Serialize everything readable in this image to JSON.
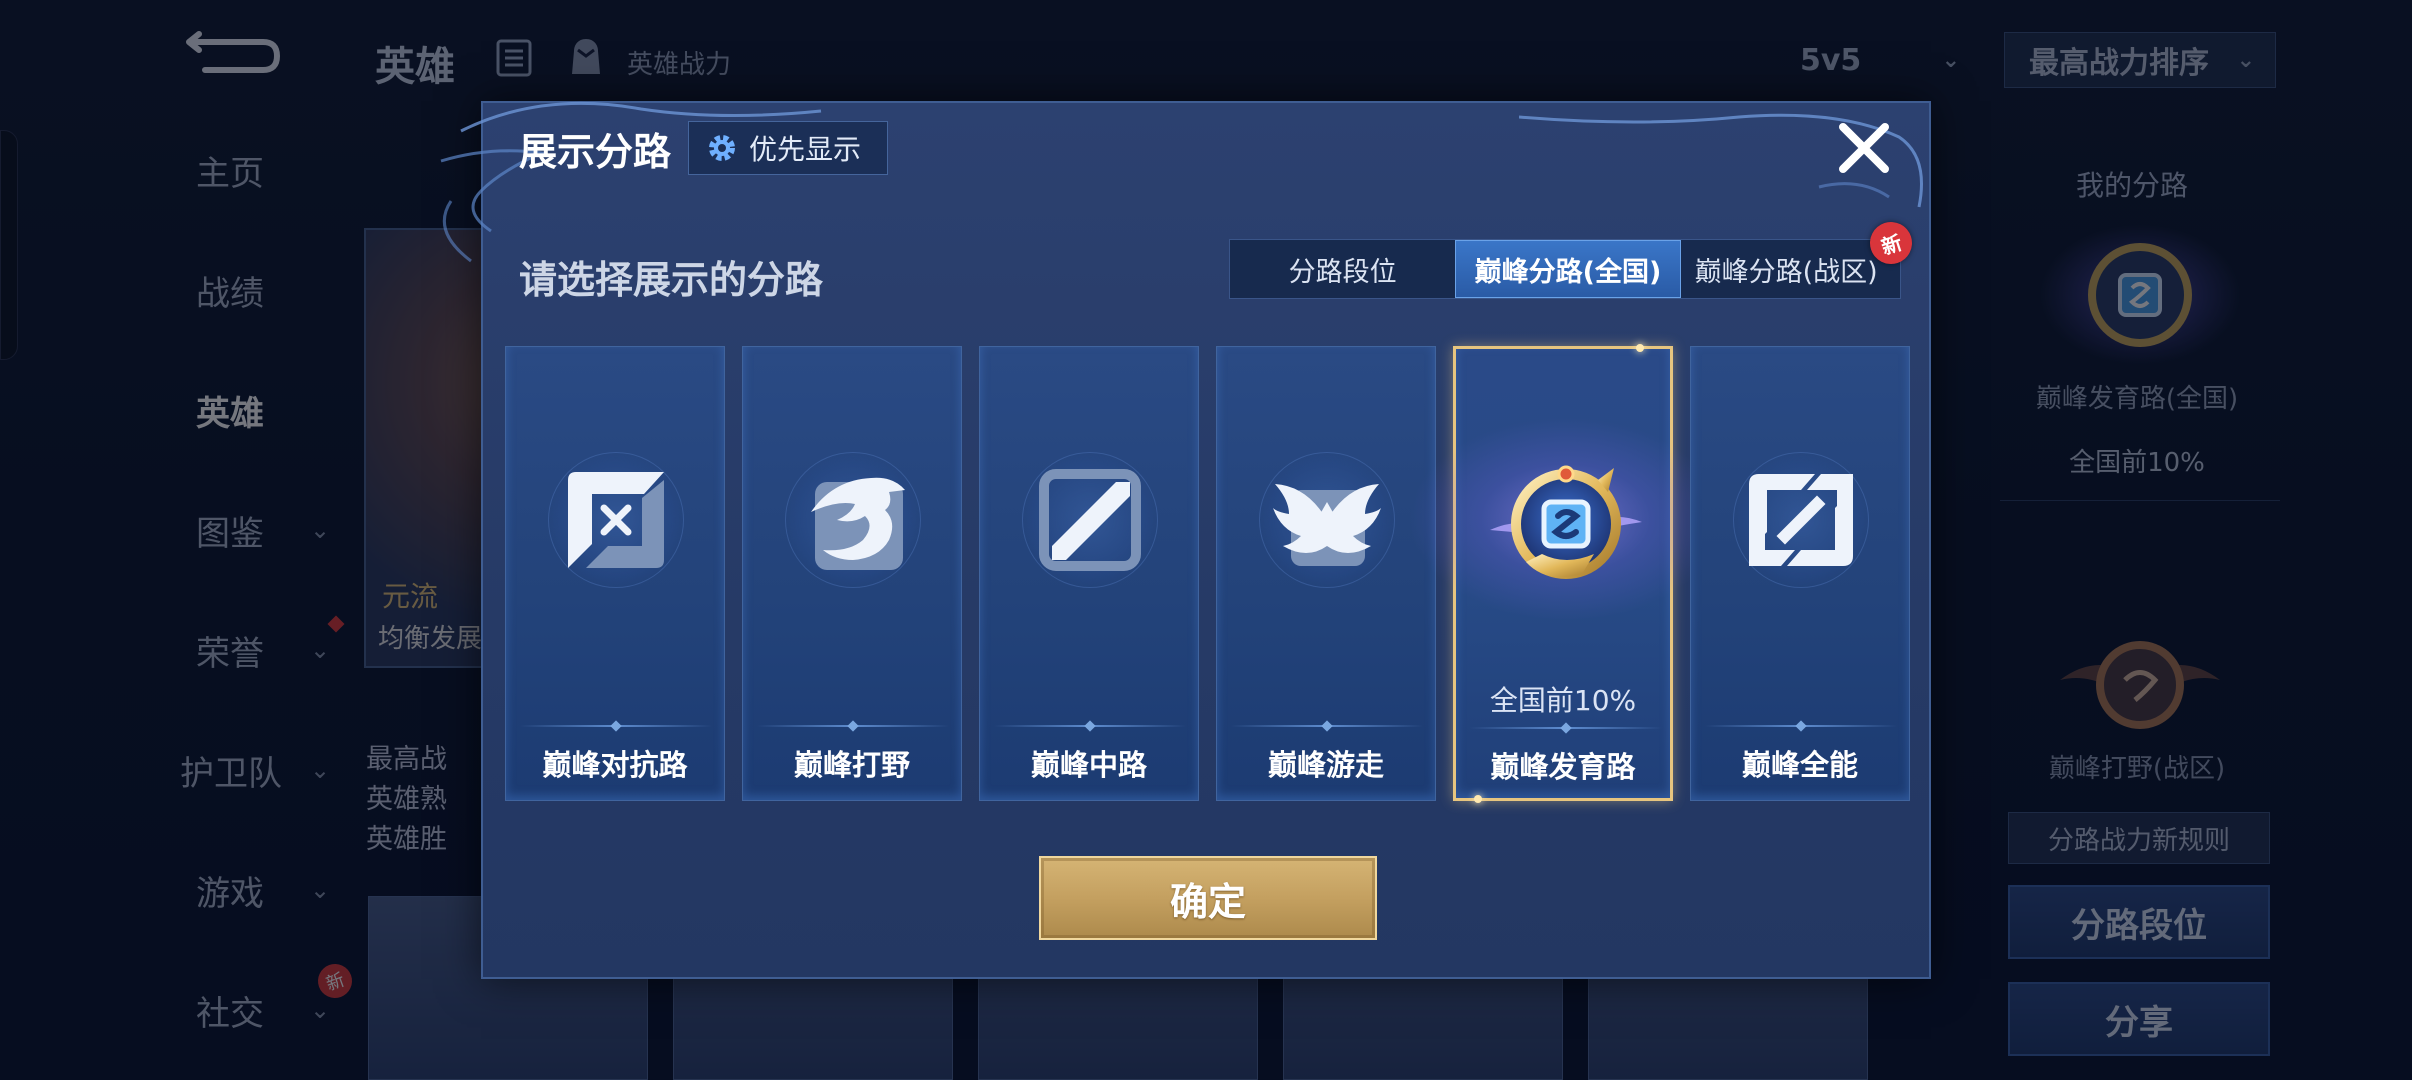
{
  "header": {
    "title": "英雄",
    "power_label": "英雄战力",
    "mode": "5v5",
    "sort": "最高战力排序"
  },
  "sidebar": {
    "items": [
      {
        "label": "主页"
      },
      {
        "label": "战绩"
      },
      {
        "label": "英雄"
      },
      {
        "label": "图鉴"
      },
      {
        "label": "荣誉"
      },
      {
        "label": "护卫队"
      },
      {
        "label": "游戏"
      },
      {
        "label": "社交",
        "badge": "新"
      }
    ]
  },
  "hero_card": {
    "tag1": "元流",
    "tag2": "均衡发展",
    "info": [
      "最高战",
      "英雄熟",
      "英雄胜"
    ]
  },
  "right_panel": {
    "title": "我的分路",
    "lane1": "巅峰发育路(全国)",
    "rank1": "全国前10%",
    "lane2": "巅峰打野(战区)",
    "rule": "分路战力新规则",
    "btn_lane": "分路段位",
    "btn_share": "分享"
  },
  "modal": {
    "title": "展示分路",
    "priority_label": "优先显示",
    "subtitle": "请选择展示的分路",
    "tabs": [
      {
        "label": "分路段位"
      },
      {
        "label": "巅峰分路(全国)"
      },
      {
        "label": "巅峰分路(战区)",
        "badge": "新"
      }
    ],
    "cards": [
      {
        "name": "巅峰对抗路",
        "icon": "clash-lane-icon"
      },
      {
        "name": "巅峰打野",
        "icon": "jungle-dragon-icon"
      },
      {
        "name": "巅峰中路",
        "icon": "mid-lane-icon"
      },
      {
        "name": "巅峰游走",
        "icon": "roam-wings-icon"
      },
      {
        "name": "巅峰发育路",
        "icon": "farm-lane-badge-icon",
        "rank": "全国前10%",
        "selected": true
      },
      {
        "name": "巅峰全能",
        "icon": "all-round-icon"
      }
    ],
    "confirm_label": "确定"
  },
  "colors": {
    "accent_gold": "#e7c57f",
    "active_tab": "#3a76c8",
    "new_badge": "#d9353b"
  }
}
